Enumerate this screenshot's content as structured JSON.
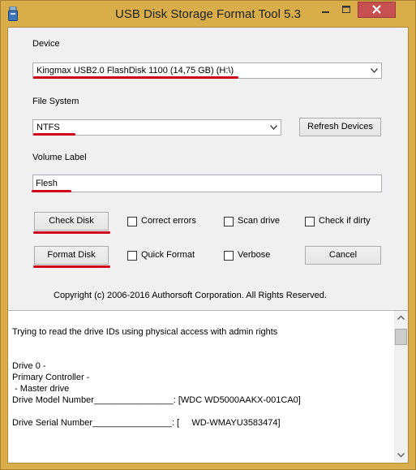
{
  "window": {
    "title": "USB Disk Storage Format Tool 5.3"
  },
  "device": {
    "label": "Device",
    "selected": "Kingmax  USB2.0 FlashDisk  1100 (14,75 GB) (H:\\)"
  },
  "file_system": {
    "label": "File System",
    "selected": "NTFS"
  },
  "refresh_button": "Refresh Devices",
  "volume_label": {
    "label": "Volume Label",
    "value": "Flesh"
  },
  "buttons": {
    "check_disk": "Check Disk",
    "format_disk": "Format Disk",
    "cancel": "Cancel"
  },
  "options": {
    "correct_errors": {
      "label": "Correct errors",
      "checked": false
    },
    "scan_drive": {
      "label": "Scan drive",
      "checked": false
    },
    "check_if_dirty": {
      "label": "Check if dirty",
      "checked": false
    },
    "quick_format": {
      "label": "Quick Format",
      "checked": false
    },
    "verbose": {
      "label": "Verbose",
      "checked": false
    }
  },
  "copyright": "Copyright (c) 2006-2016 Authorsoft Corporation. All Rights Reserved.",
  "log": {
    "lines": [
      "Trying to read the drive IDs using physical access with admin rights",
      "Drive 0 -",
      "Primary Controller -",
      " - Master drive",
      "Drive Model Number________________: [WDC WD5000AAKX-001CA0]",
      "Drive Serial Number________________: [     WD-WMAYU3583474]"
    ]
  },
  "colors": {
    "title_bar": "#d8ad4a",
    "close_button": "#c75050",
    "annotation_underline": "#d0021b",
    "dialog_background": "#f0f0f0"
  }
}
